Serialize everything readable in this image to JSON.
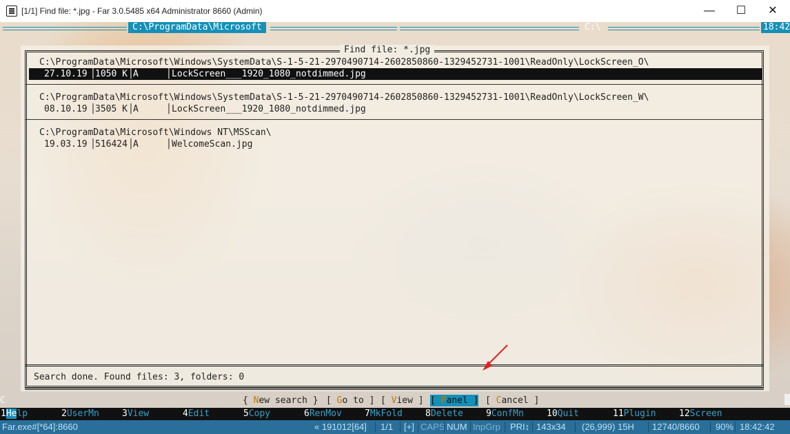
{
  "window": {
    "title": "[1/1] Find file: *.jpg - Far 3.0.5485 x64 Administrator 8660 (Admin)",
    "minimize_glyph": "—",
    "maximize_glyph": "☐",
    "close_glyph": "✕"
  },
  "panels": {
    "left_path": "C:\\ProgramData\\Microsoft",
    "right_path": "C:\\",
    "clock": "18:42"
  },
  "dialog": {
    "title": "Find file: *.jpg",
    "groups": [
      {
        "folder": "C:\\ProgramData\\Microsoft\\Windows\\SystemData\\S-1-5-21-2970490714-2602850860-1329452731-1001\\ReadOnly\\LockScreen_O\\",
        "date": "27.10.19",
        "size": "1050 K",
        "attr": "A",
        "name": "LockScreen___1920_1080_notdimmed.jpg",
        "selected": true
      },
      {
        "folder": "C:\\ProgramData\\Microsoft\\Windows\\SystemData\\S-1-5-21-2970490714-2602850860-1329452731-1001\\ReadOnly\\LockScreen_W\\",
        "date": "08.10.19",
        "size": "3505 K",
        "attr": "A",
        "name": "LockScreen___1920_1080_notdimmed.jpg",
        "selected": false
      },
      {
        "folder": "C:\\ProgramData\\Microsoft\\Windows NT\\MSScan\\",
        "date": "19.03.19",
        "size": "516424",
        "attr": "A",
        "name": "WelcomeScan.jpg",
        "selected": false
      }
    ],
    "status": "Search done. Found files: 3, folders: 0",
    "buttons": {
      "new_search": {
        "open": "{ ",
        "hot": "N",
        "rest": "ew search",
        "close": " }"
      },
      "goto": {
        "open": "[ ",
        "hot": "G",
        "rest": "o to",
        "close": " ]"
      },
      "view": {
        "open": "[ ",
        "hot": "V",
        "rest": "iew",
        "close": " ]"
      },
      "panel": {
        "open": "[ ",
        "hot": "P",
        "rest": "anel",
        "close": " ]"
      },
      "cancel": {
        "open": "[ ",
        "hot": "C",
        "rest": "ancel",
        "close": " ]"
      }
    }
  },
  "keybar": [
    {
      "num": "1",
      "first": "He",
      "rest": "lp"
    },
    {
      "num": "2",
      "first": "",
      "rest": "UserMn"
    },
    {
      "num": "3",
      "first": "",
      "rest": "View"
    },
    {
      "num": "4",
      "first": "",
      "rest": "Edit"
    },
    {
      "num": "5",
      "first": "",
      "rest": "Copy"
    },
    {
      "num": "6",
      "first": "",
      "rest": "RenMov"
    },
    {
      "num": "7",
      "first": "",
      "rest": "MkFold"
    },
    {
      "num": "8",
      "first": "",
      "rest": "Delete"
    },
    {
      "num": "9",
      "first": "",
      "rest": "ConfMn"
    },
    {
      "num": "10",
      "first": "",
      "rest": "Quit"
    },
    {
      "num": "11",
      "first": "",
      "rest": "Plugin"
    },
    {
      "num": "12",
      "first": "",
      "rest": "Screen"
    }
  ],
  "statusbar": {
    "process": "Far.exe#[*64]:8660",
    "position": "« 191012[64]",
    "page": "1/1",
    "plus": "[+]",
    "caps": "CAPS",
    "num": "NUM",
    "inpgrp": "InpGrp",
    "pri": "PRI↕",
    "size": "143x34",
    "coords": "(26,999) 15H",
    "pids": "12740/8660",
    "zoom": "90%",
    "time": "18:42:42"
  },
  "cursor_char": "C"
}
